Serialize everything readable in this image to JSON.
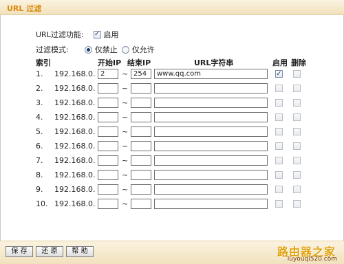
{
  "header": {
    "title": "URL 过滤"
  },
  "filter_function": {
    "label": "URL过滤功能:",
    "enabled": true,
    "enable_label": "启用"
  },
  "filter_mode": {
    "label": "过滤模式:",
    "options": [
      {
        "label": "仅禁止",
        "selected": true
      },
      {
        "label": "仅允许",
        "selected": false
      }
    ]
  },
  "table": {
    "headers": {
      "index": "索引",
      "start_ip": "开始IP",
      "end_ip": "结束IP",
      "url": "URL字符串",
      "enable": "启用",
      "delete": "删除"
    },
    "rows": [
      {
        "num": "1.",
        "prefix": "192.168.0.",
        "start": "2",
        "end": "254",
        "url": "www.qq.com",
        "enabled": true,
        "deleted": false
      },
      {
        "num": "2.",
        "prefix": "192.168.0.",
        "start": "",
        "end": "",
        "url": "",
        "enabled": false,
        "deleted": false
      },
      {
        "num": "3.",
        "prefix": "192.168.0.",
        "start": "",
        "end": "",
        "url": "",
        "enabled": false,
        "deleted": false
      },
      {
        "num": "4.",
        "prefix": "192.168.0.",
        "start": "",
        "end": "",
        "url": "",
        "enabled": false,
        "deleted": false
      },
      {
        "num": "5.",
        "prefix": "192.168.0.",
        "start": "",
        "end": "",
        "url": "",
        "enabled": false,
        "deleted": false
      },
      {
        "num": "6.",
        "prefix": "192.168.0.",
        "start": "",
        "end": "",
        "url": "",
        "enabled": false,
        "deleted": false
      },
      {
        "num": "7.",
        "prefix": "192.168.0.",
        "start": "",
        "end": "",
        "url": "",
        "enabled": false,
        "deleted": false
      },
      {
        "num": "8.",
        "prefix": "192.168.0.",
        "start": "",
        "end": "",
        "url": "",
        "enabled": false,
        "deleted": false
      },
      {
        "num": "9.",
        "prefix": "192.168.0.",
        "start": "",
        "end": "",
        "url": "",
        "enabled": false,
        "deleted": false
      },
      {
        "num": "10.",
        "prefix": "192.168.0.",
        "start": "",
        "end": "",
        "url": "",
        "enabled": false,
        "deleted": false
      }
    ]
  },
  "buttons": {
    "save": "保 存",
    "restore": "还 原",
    "help": "帮 助"
  },
  "watermark": {
    "name": "路由器之家",
    "url": "luyouqi520.com"
  },
  "icons": {
    "check": "check-icon",
    "radio_dot": "radio-dot-icon"
  }
}
